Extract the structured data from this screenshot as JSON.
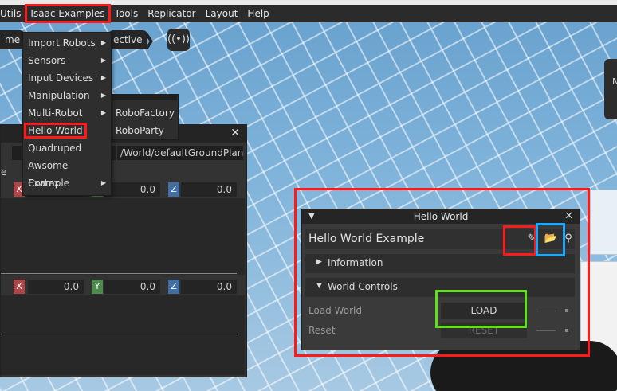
{
  "menubar": {
    "items": [
      "Utils",
      "Isaac Examples",
      "Tools",
      "Replicator",
      "Layout",
      "Help"
    ]
  },
  "toolbar": {
    "left_pill": "me",
    "perspective_pill": "ective",
    "broadcast_icon": "broadcast-icon"
  },
  "side_tab": {
    "label": "N"
  },
  "dropdown": {
    "items": [
      {
        "label": "Import Robots",
        "submenu": true
      },
      {
        "label": "Sensors",
        "submenu": true
      },
      {
        "label": "Input Devices",
        "submenu": true
      },
      {
        "label": "Manipulation",
        "submenu": true
      },
      {
        "label": "Multi-Robot",
        "submenu": true
      },
      {
        "label": "Hello World",
        "submenu": false
      },
      {
        "label": "Quadruped",
        "submenu": false
      },
      {
        "label": "Awsome Example",
        "submenu": false
      },
      {
        "label": "Cortex",
        "submenu": true
      }
    ],
    "submenu_items": [
      "RoboFactory",
      "RoboParty"
    ]
  },
  "property_window": {
    "close": "✕",
    "path": "/World/defaultGroundPlane",
    "partial_label": "e",
    "row1": {
      "x": "X",
      "y_value": "0.0",
      "z": "Z",
      "z_value": "0.0"
    },
    "row2": {
      "x": "X",
      "x_value": "0.0",
      "y": "Y",
      "y_value": "0.0",
      "z": "Z",
      "z_value": "0.0"
    }
  },
  "hello_world": {
    "window_title": "Hello World",
    "close": "✕",
    "header_title": "Hello World Example",
    "sections": {
      "information": "Information",
      "world_controls": "World Controls"
    },
    "controls": {
      "load_label": "Load World",
      "load_button": "LOAD",
      "reset_label": "Reset",
      "reset_button": "RESET"
    }
  }
}
